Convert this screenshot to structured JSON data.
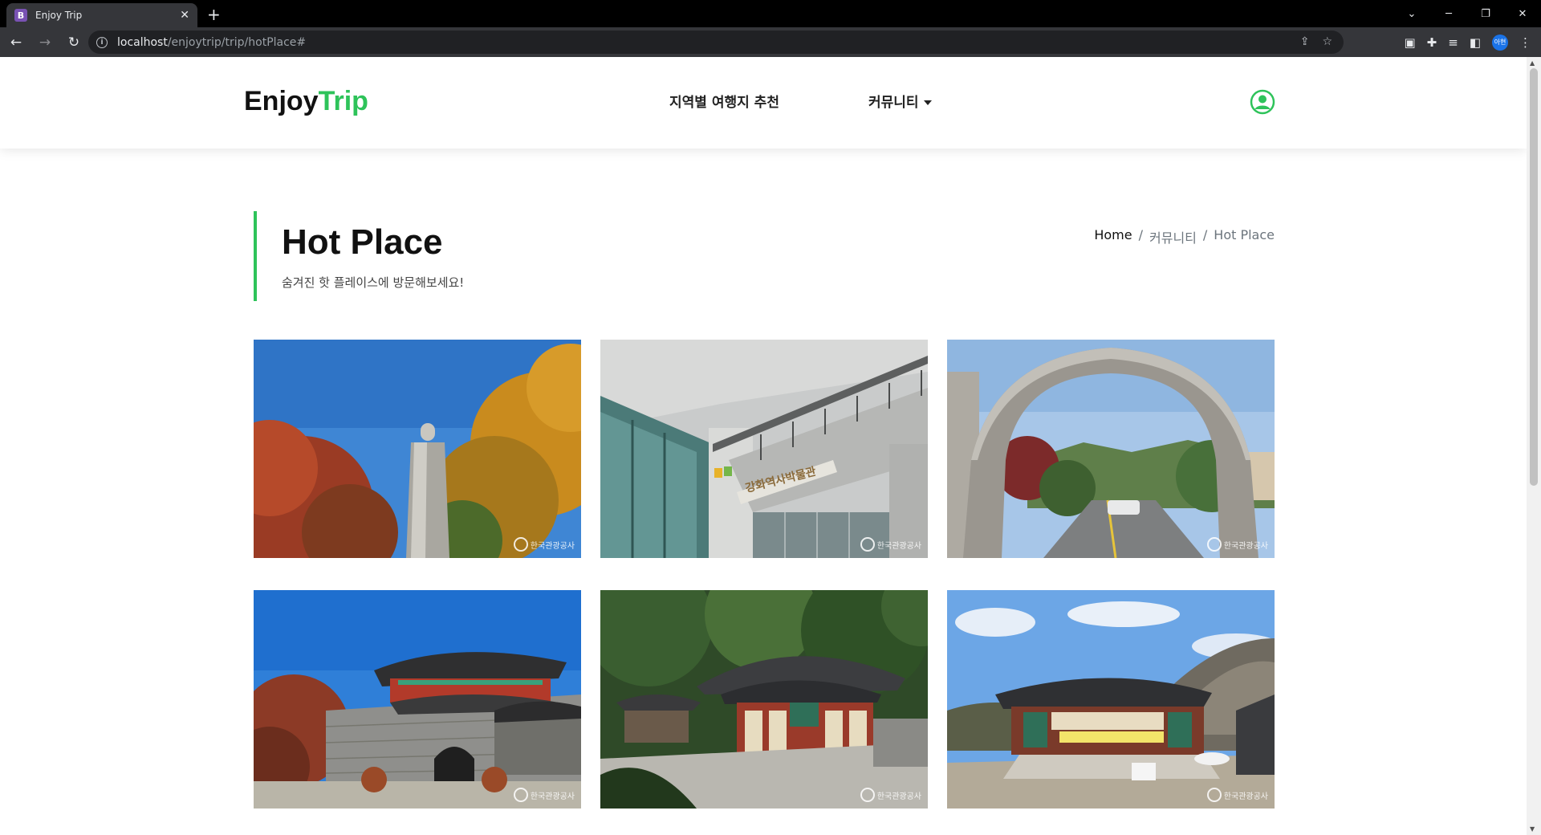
{
  "browser": {
    "tab_favicon": "B",
    "tab_title": "Enjoy Trip",
    "url_host": "localhost",
    "url_path": "/enjoytrip/trip/hotPlace#",
    "profile_label": "아현"
  },
  "header": {
    "logo_main": "Enjoy",
    "logo_accent": "Trip",
    "nav_region": "지역별 여행지 추천",
    "nav_community": "커뮤니티"
  },
  "page": {
    "title": "Hot Place",
    "subtitle": "숨겨진 핫 플레이스에 방문해보세요!",
    "breadcrumb": [
      "Home",
      "커뮤니티",
      "Hot Place"
    ],
    "breadcrumb_sep": "/"
  },
  "gallery": {
    "watermark": "한국관광공사",
    "museum_sign": "강화역사박물관"
  },
  "colors": {
    "accent": "#2ec35a"
  }
}
